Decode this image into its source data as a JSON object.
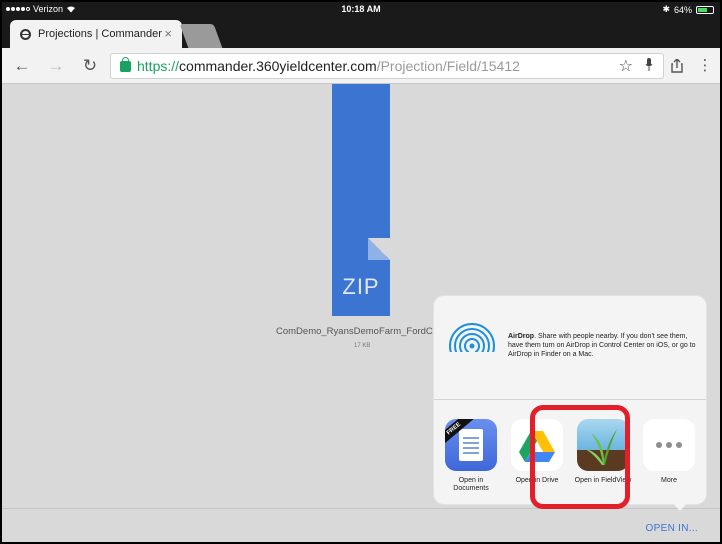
{
  "status_bar": {
    "carrier": "Verizon",
    "time": "10:18 AM",
    "battery": "64%",
    "battery_level": 0.64
  },
  "browser": {
    "tab_title": "Projections | Commander",
    "tab_close": "×",
    "url_scheme": "https://",
    "url_host": "commander.360yieldcenter.com",
    "url_path": "/Projection/Field/15412"
  },
  "download": {
    "file_type": "ZIP",
    "filename": "ComDemo_RyansDemoFarm_FordCLU",
    "size": "17 KB",
    "open_in_label": "OPEN IN..."
  },
  "share_sheet": {
    "airdrop_title": "AirDrop",
    "airdrop_text": ". Share with people nearby. If you don't see them, have them turn on AirDrop in Control Center on iOS, or go to AirDrop in Finder on a Mac.",
    "apps": [
      {
        "label": "Open in Documents",
        "icon": "documents-icon",
        "badge": "FREE"
      },
      {
        "label": "Open in Drive",
        "icon": "google-drive-icon"
      },
      {
        "label": "Open in FieldView",
        "icon": "fieldview-icon"
      },
      {
        "label": "More",
        "icon": "more-icon"
      }
    ],
    "highlight_color": "#e3202a"
  },
  "colors": {
    "accent": "#3b74d1",
    "secure_green": "#1aa260"
  }
}
